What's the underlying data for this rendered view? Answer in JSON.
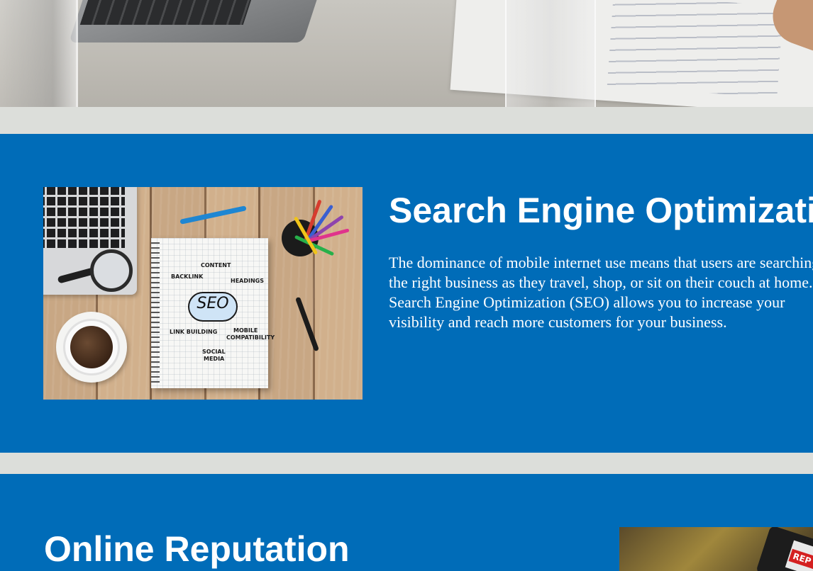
{
  "hero": {
    "image_alt": "Desk with laptop, glass of water and printed documents"
  },
  "seo": {
    "title": "Search Engine Optimization",
    "description": "The dominance of mobile internet use means that users are searching for the right business as they travel, shop, or sit on their couch at home. Search Engine Optimization (SEO) allows you to increase your visibility and reach more customers for your business.",
    "notebook": {
      "center_word": "SEO",
      "words": {
        "content": "CONTENT",
        "backlink": "BACKLINK",
        "headings": "HEADINGS",
        "link_building": "LINK BUILDING",
        "mobile": "MOBILE",
        "compatibility": "COMPATIBILITY",
        "social": "SOCIAL",
        "media": "MEDIA"
      }
    }
  },
  "reputation": {
    "title": "Online Reputation",
    "badge_text": "REP"
  },
  "colors": {
    "section_blue": "#006cb8",
    "gap_gray": "#dcdeda",
    "text_white": "#ffffff"
  }
}
